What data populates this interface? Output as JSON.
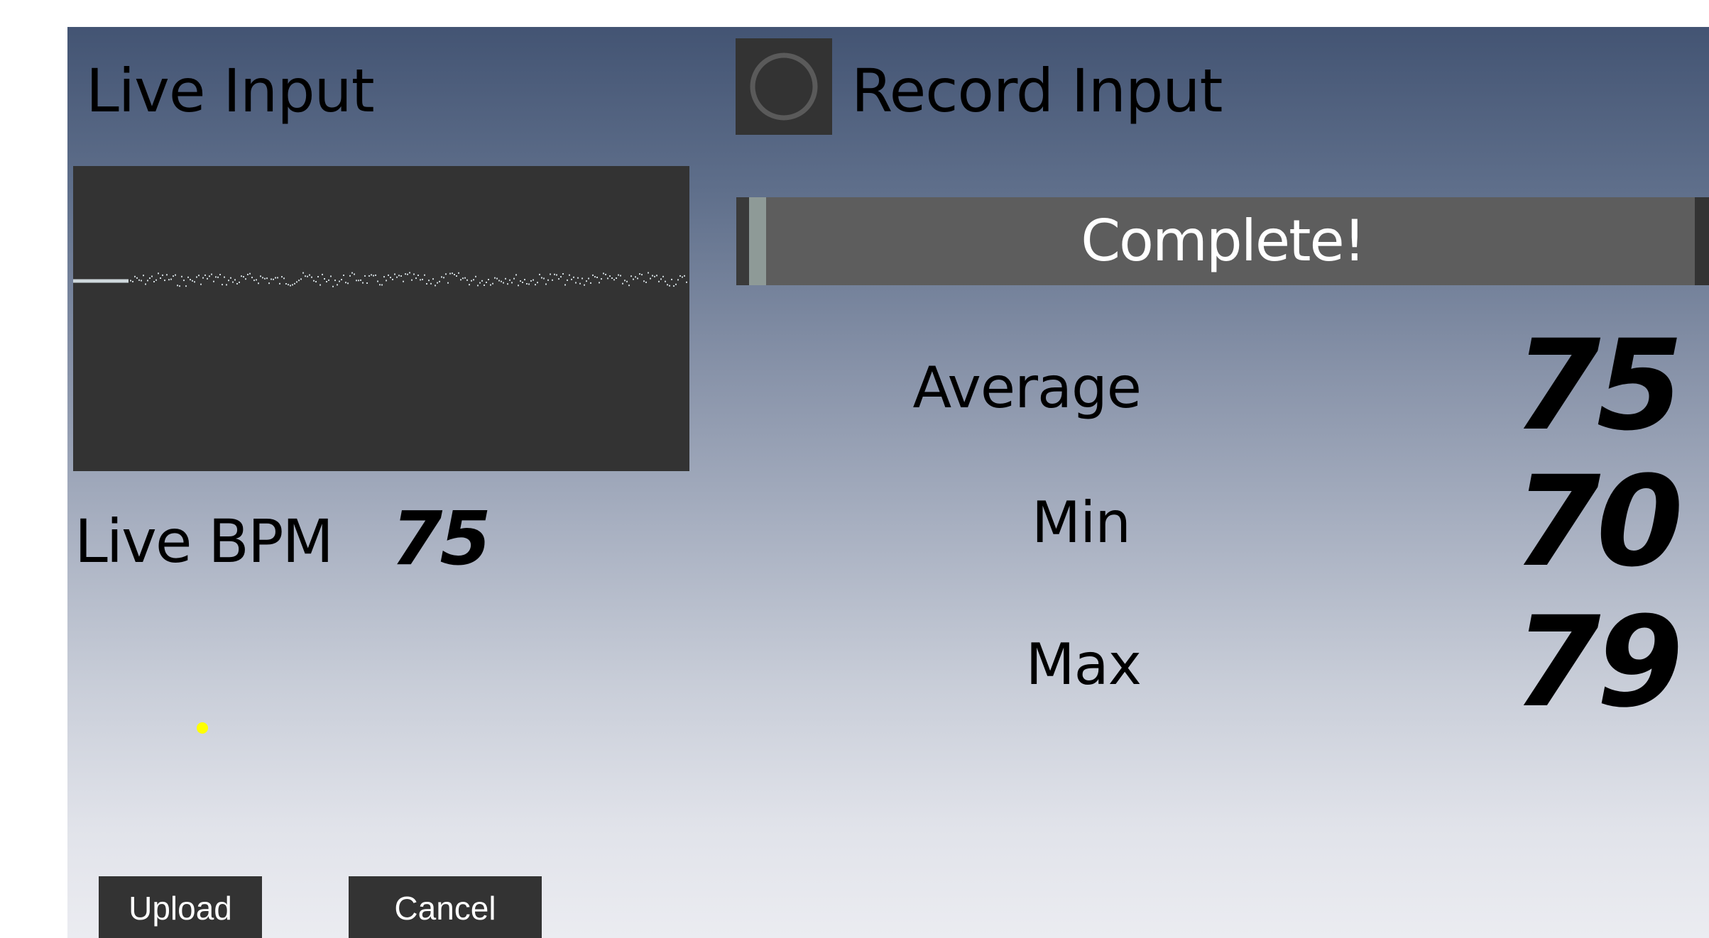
{
  "live_input": {
    "title": "Live Input",
    "bpm_label": "Live BPM",
    "bpm_value": "75"
  },
  "record": {
    "title": "Record Input",
    "status": "Complete!",
    "progress_percent": 100
  },
  "stats": {
    "average_label": "Average",
    "average_value": "75",
    "min_label": "Min",
    "min_value": "70",
    "max_label": "Max",
    "max_value": "79"
  },
  "actions": {
    "upload_label": "Upload",
    "cancel_label": "Cancel"
  },
  "colors": {
    "panel_top": "#435473",
    "panel_bottom": "#ebecf1",
    "control_bg": "#333333",
    "progress_bg": "#5d5d5d",
    "waveform": "#cfd8dc",
    "cursor": "#ffff00"
  },
  "icons": {
    "record": "record-circle-icon"
  }
}
